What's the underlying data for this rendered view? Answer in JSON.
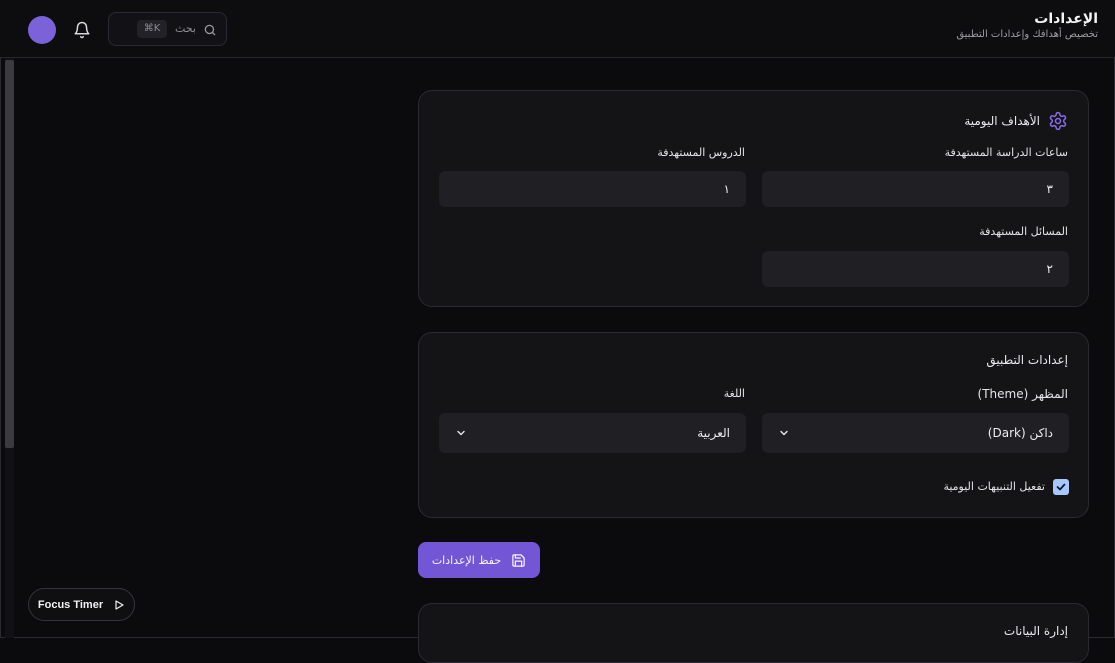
{
  "header": {
    "title": "الإعدادات",
    "subtitle": "تخصيص أهدافك وإعدادات التطبيق",
    "search_placeholder": "بحث",
    "search_shortcut": "⌘K"
  },
  "daily_goals": {
    "title": "الأهداف اليومية",
    "study_hours_label": "ساعات الدراسة المستهدفة",
    "study_hours_value": "٣",
    "lessons_label": "الدروس المستهدفة",
    "lessons_value": "١",
    "problems_label": "المسائل المستهدفة",
    "problems_value": "٢"
  },
  "app_settings": {
    "title": "إعدادات التطبيق",
    "theme_label": "المظهر (Theme)",
    "theme_value": "داكن (Dark)",
    "language_label": "اللغة",
    "language_value": "العربية",
    "notifications_label": "تفعيل التنبيهات اليومية",
    "notifications_checked": true
  },
  "actions": {
    "save_label": "حفظ الإعدادات"
  },
  "data_management": {
    "title": "إدارة البيانات"
  },
  "focus_timer": {
    "label": "Focus Timer"
  },
  "colors": {
    "accent": "#7256d6",
    "avatar": "#7c62d8",
    "checkbox": "#a8c7fa"
  }
}
